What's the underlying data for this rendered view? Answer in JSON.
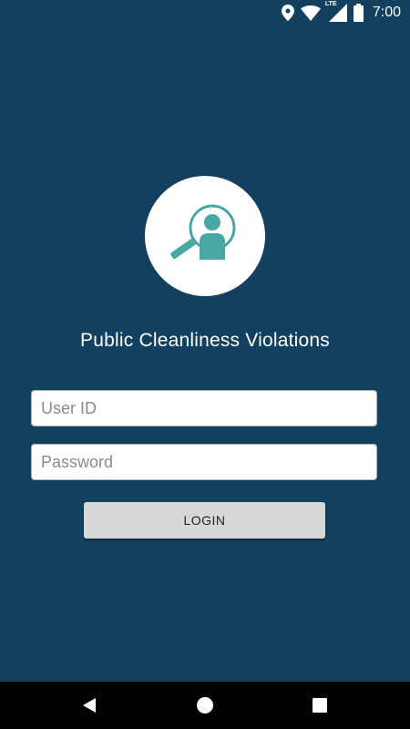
{
  "status_bar": {
    "time": "7:00",
    "network_label": "LTE",
    "icons": [
      "location-icon",
      "wifi-icon",
      "signal-icon",
      "battery-icon"
    ]
  },
  "app": {
    "title": "Public Cleanliness Violations",
    "logo": "magnifier-person-icon"
  },
  "login_form": {
    "user_id_placeholder": "User ID",
    "user_id_value": "",
    "password_placeholder": "Password",
    "password_value": "",
    "login_label": "LOGIN"
  },
  "nav_bar": {
    "buttons": [
      "back-icon",
      "home-icon",
      "recents-icon"
    ]
  },
  "colors": {
    "background": "#12405e",
    "accent": "#4aa8a4",
    "button": "#d6d7d7",
    "nav_bar": "#000000"
  }
}
